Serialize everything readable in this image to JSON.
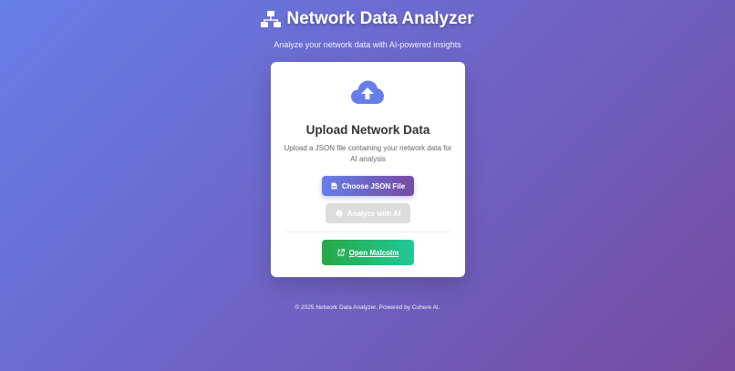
{
  "header": {
    "title": "Network Data Analyzer",
    "subtitle": "Analyze your network data with AI-powered insights",
    "icon": "network-icon"
  },
  "card": {
    "icon": "cloud-upload-icon",
    "title": "Upload Network Data",
    "description": "Upload a JSON file containing your network data for AI analysis",
    "choose_button": {
      "label": "Choose JSON File",
      "icon": "file-icon"
    },
    "analyze_button": {
      "label": "Analyze with AI",
      "icon": "brain-icon",
      "disabled": true
    },
    "malcolm_link": {
      "label": "Open Malcolm",
      "icon": "external-link-icon"
    }
  },
  "footer": {
    "text": "© 2025 Network Data Analyzer. Powered by Cohere AI."
  },
  "colors": {
    "background_start": "#667eea",
    "background_end": "#764ba2",
    "success_start": "#28a745",
    "success_end": "#20c997",
    "disabled": "#dddddd"
  }
}
